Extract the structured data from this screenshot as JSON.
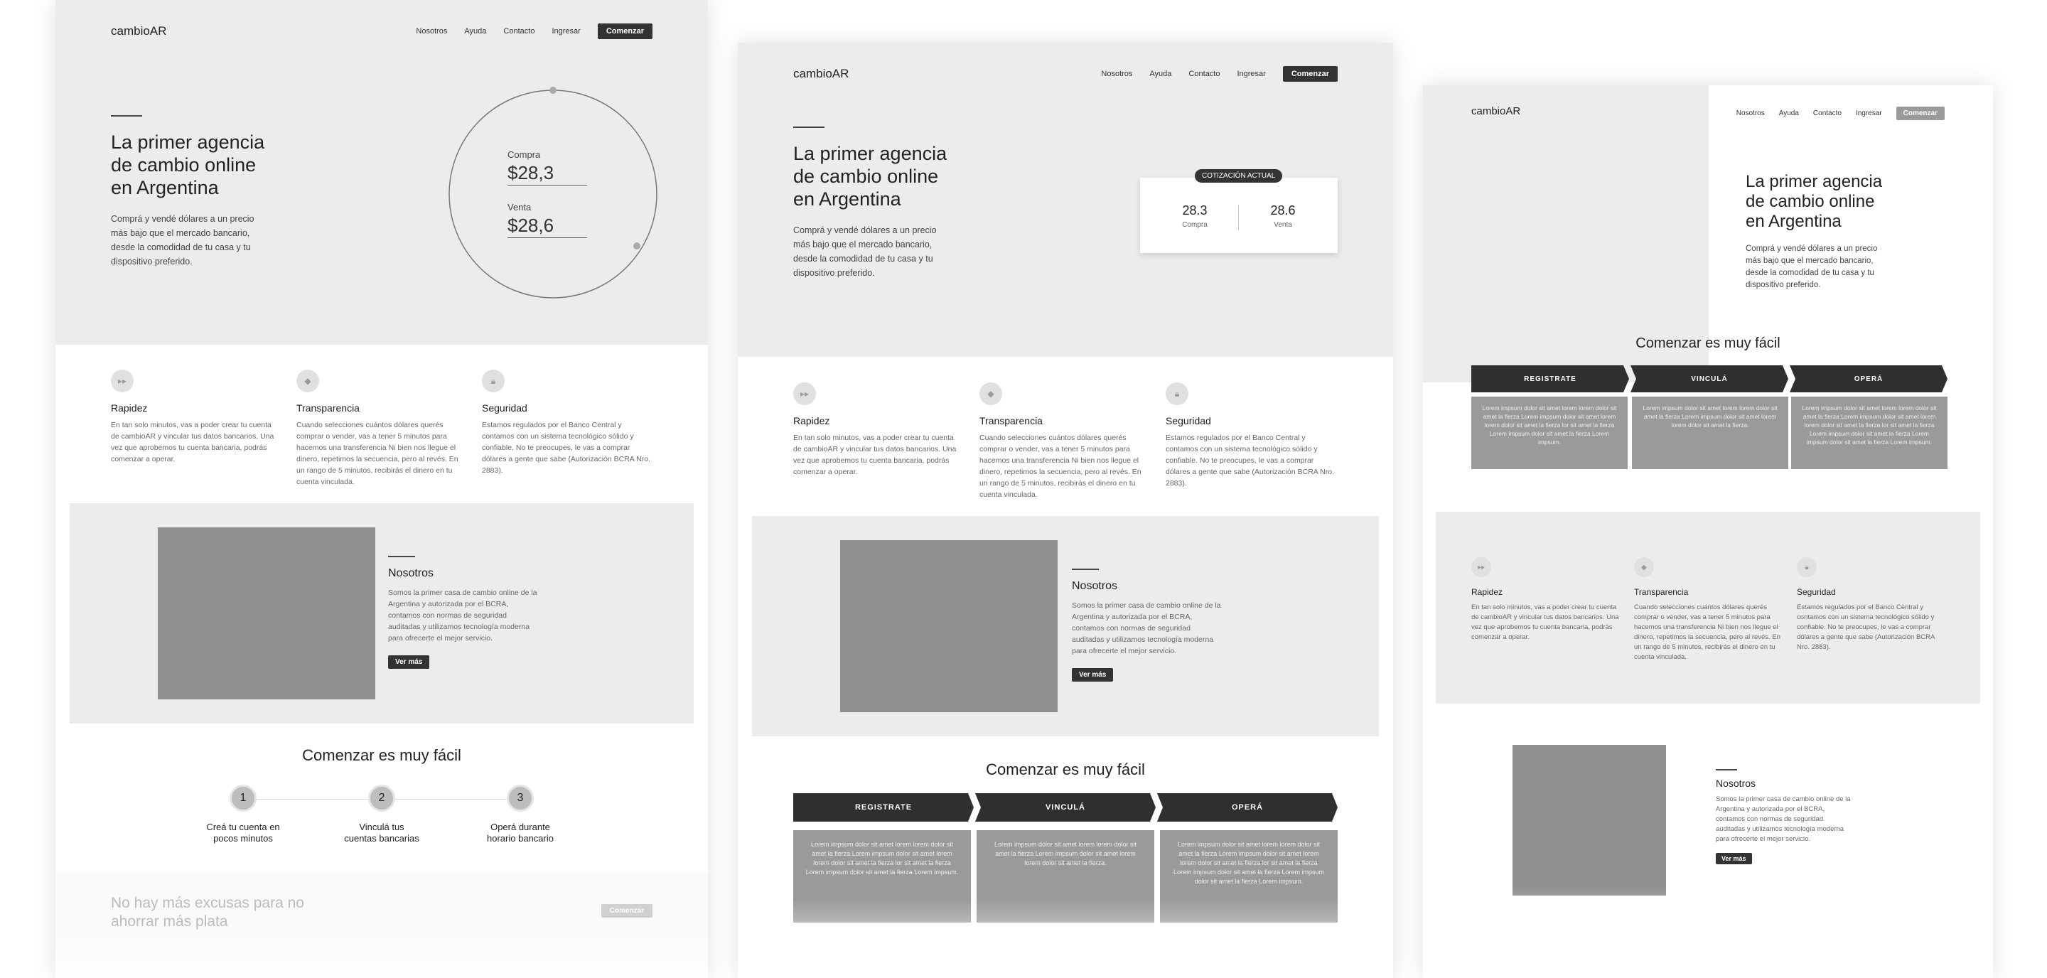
{
  "brand": "cambioAR",
  "nav": [
    "Nosotros",
    "Ayuda",
    "Contacto",
    "Ingresar"
  ],
  "cta": "Comenzar",
  "hero": {
    "title_lines": [
      "La primer agencia",
      "de cambio online",
      "en Argentina"
    ],
    "subtitle_lines": [
      "Comprá y vendé dólares a un precio",
      "más bajo que el mercado bancario,",
      "desde la comodidad de tu casa y tu",
      "dispositivo preferido."
    ]
  },
  "rates": {
    "compra_label": "Compra",
    "compra_value": "$28,3",
    "venta_label": "Venta",
    "venta_value": "$28,6"
  },
  "cotizacion": {
    "badge": "COTIZACIÓN ACTUAL",
    "compra_value": "28.3",
    "compra_label": "Compra",
    "venta_value": "28.6",
    "venta_label": "Venta"
  },
  "features": [
    {
      "icon": "fast-forward-icon",
      "title": "Rapidez",
      "text": "En tan solo minutos, vas a poder crear tu cuenta de cambioAR y vincular tus datos bancarios. Una vez que aprobemos tu cuenta bancaria, podrás comenzar a operar."
    },
    {
      "icon": "tag-icon",
      "title": "Transparencia",
      "text": "Cuando selecciones cuántos dólares querés comprar o vender, vas a tener 5 minutos para hacemos una transferencia Ni bien nos llegue el dinero, repetimos la secuencia, pero al revés. En un rango de 5 minutos, recibirás el dinero en tu cuenta vinculada."
    },
    {
      "icon": "lock-icon",
      "title": "Seguridad",
      "text": "Estamos regulados por el Banco Central y contamos con un sistema tecnológico sólido y confiable. No te preocupes, le vas a comprar dólares a gente que sabe (Autorización BCRA Nro. 2883)."
    }
  ],
  "about": {
    "title": "Nosotros",
    "text": "Somos la primer casa de cambio online de la Argentina y autorizada por el BCRA, contamos con normas de seguridad auditadas y utilizamos tecnología moderna para ofrecerte el mejor servicio.",
    "button": "Ver más"
  },
  "easy_title": "Comenzar es muy fácil",
  "steps": [
    {
      "num": "1",
      "line1": "Creá tu cuenta en",
      "line2": "pocos minutos"
    },
    {
      "num": "2",
      "line1": "Vinculá tus",
      "line2": "cuentas bancarias"
    },
    {
      "num": "3",
      "line1": "Operá durante",
      "line2": "horario bancario"
    }
  ],
  "arrow_steps": [
    "REGISTRATE",
    "VINCULÁ",
    "OPERÁ"
  ],
  "lorem": [
    "Lorem impsum dolor sit amet lorem lorem dolor sit amet la fierza Lorem impsum dolor sit amet lorem lorem dolor sit amet la fierza lor sit amet la fierza Lorem impsum dolor sit amet la fierza Lorem impsum.",
    "Lorem impsum dolor sit amet lorem lorem dolor sit amet la fierza Lorem impsum dolor sit amet lorem lorem dolor sit amet la fierza.",
    "Lorem impsum dolor sit amet lorem lorem dolor sit amet la fierza Lorem impsum dolor sit amet lorem lorem dolor sit amet la fierza lor sit amet la fierza Lorem impsum dolor sit amet la fierza Lorem impsum dolor sit amet la fierza Lorem impsum."
  ],
  "footer_cta": {
    "line1": "No hay más excusas para no",
    "line2": "ahorrar más plata",
    "button": "Comenzar"
  }
}
